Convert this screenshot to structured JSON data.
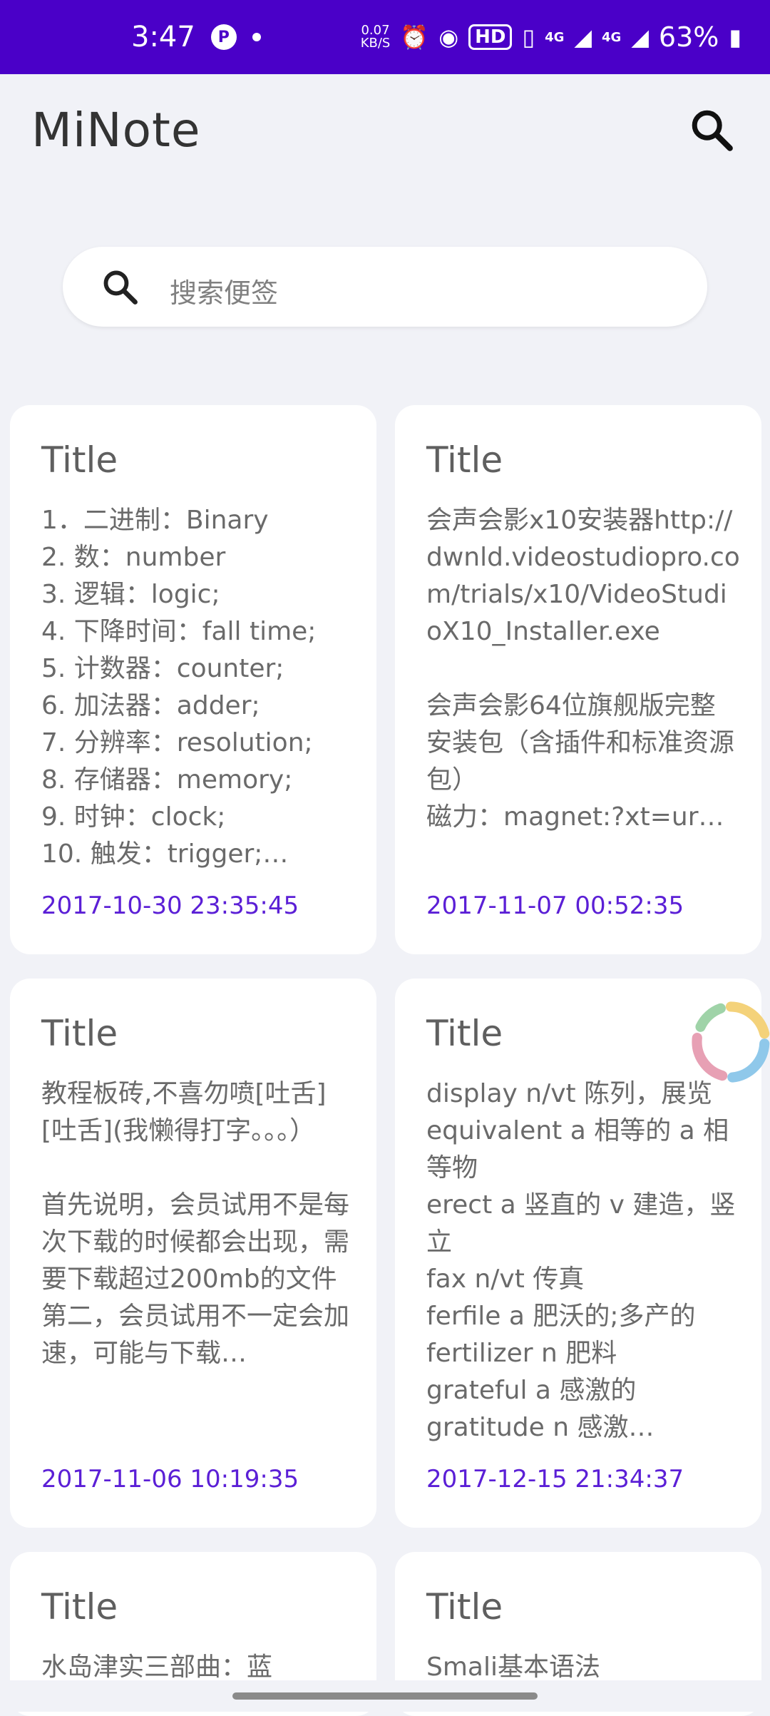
{
  "status_bar": {
    "time": "3:47",
    "net_speed_value": "0.07",
    "net_speed_unit": "KB/S",
    "hd_label": "HD",
    "network_1": "4G",
    "network_2": "4G",
    "battery": "63%"
  },
  "app": {
    "title": "MiNote"
  },
  "search": {
    "placeholder": "搜索便签"
  },
  "notes": [
    {
      "title": "Title",
      "body": "1．二进制：Binary\n2. 数：number\n3. 逻辑：logic;\n4. 下降时间：fall time;\n5. 计数器：counter;\n6. 加法器：adder;\n7. 分辨率：resolution;\n8. 存储器：memory;\n9. 时钟：clock;\n10. 触发：trigger;…",
      "date": "2017-10-30 23:35:45"
    },
    {
      "title": "Title",
      "body": "会声会影x10安装器http://dwnld.videostudiopro.com/trials/x10/VideoStudioX10_Installer.exe\n\n会声会影64位旗舰版完整安装包（含插件和标准资源包）\n磁力：magnet:?xt=ur…",
      "date": "2017-11-07 00:52:35"
    },
    {
      "title": "Title",
      "body": "教程板砖,不喜勿喷[吐舌][吐舌](我懒得打字。。。）\n\n首先说明，会员试用不是每次下载的时候都会出现，需要下载超过200mb的文件\n第二，会员试用不一定会加速，可能与下载…",
      "date": "2017-11-06 10:19:35"
    },
    {
      "title": "Title",
      "body": "display n/vt 陈列，展览\nequivalent a 相等的 a 相等物\nerect a 竖直的 v 建造，竖立\nfax n/vt 传真\nferfile a 肥沃的;多产的\nfertilizer n 肥料\ngrateful a 感激的\ngratitude n 感激…",
      "date": "2017-12-15 21:34:37"
    },
    {
      "title": "Title",
      "body": "水岛津实三部曲：蓝",
      "date": ""
    },
    {
      "title": "Title",
      "body": "Smali基本语法",
      "date": ""
    }
  ]
}
